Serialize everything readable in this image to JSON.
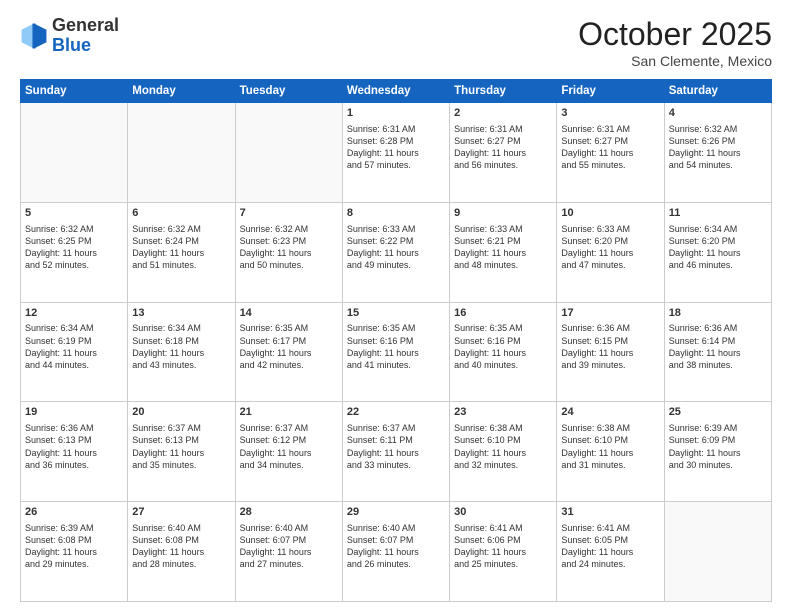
{
  "header": {
    "logo_general": "General",
    "logo_blue": "Blue",
    "month_title": "October 2025",
    "location": "San Clemente, Mexico"
  },
  "days_of_week": [
    "Sunday",
    "Monday",
    "Tuesday",
    "Wednesday",
    "Thursday",
    "Friday",
    "Saturday"
  ],
  "weeks": [
    [
      {
        "day": "",
        "info": ""
      },
      {
        "day": "",
        "info": ""
      },
      {
        "day": "",
        "info": ""
      },
      {
        "day": "1",
        "info": "Sunrise: 6:31 AM\nSunset: 6:28 PM\nDaylight: 11 hours\nand 57 minutes."
      },
      {
        "day": "2",
        "info": "Sunrise: 6:31 AM\nSunset: 6:27 PM\nDaylight: 11 hours\nand 56 minutes."
      },
      {
        "day": "3",
        "info": "Sunrise: 6:31 AM\nSunset: 6:27 PM\nDaylight: 11 hours\nand 55 minutes."
      },
      {
        "day": "4",
        "info": "Sunrise: 6:32 AM\nSunset: 6:26 PM\nDaylight: 11 hours\nand 54 minutes."
      }
    ],
    [
      {
        "day": "5",
        "info": "Sunrise: 6:32 AM\nSunset: 6:25 PM\nDaylight: 11 hours\nand 52 minutes."
      },
      {
        "day": "6",
        "info": "Sunrise: 6:32 AM\nSunset: 6:24 PM\nDaylight: 11 hours\nand 51 minutes."
      },
      {
        "day": "7",
        "info": "Sunrise: 6:32 AM\nSunset: 6:23 PM\nDaylight: 11 hours\nand 50 minutes."
      },
      {
        "day": "8",
        "info": "Sunrise: 6:33 AM\nSunset: 6:22 PM\nDaylight: 11 hours\nand 49 minutes."
      },
      {
        "day": "9",
        "info": "Sunrise: 6:33 AM\nSunset: 6:21 PM\nDaylight: 11 hours\nand 48 minutes."
      },
      {
        "day": "10",
        "info": "Sunrise: 6:33 AM\nSunset: 6:20 PM\nDaylight: 11 hours\nand 47 minutes."
      },
      {
        "day": "11",
        "info": "Sunrise: 6:34 AM\nSunset: 6:20 PM\nDaylight: 11 hours\nand 46 minutes."
      }
    ],
    [
      {
        "day": "12",
        "info": "Sunrise: 6:34 AM\nSunset: 6:19 PM\nDaylight: 11 hours\nand 44 minutes."
      },
      {
        "day": "13",
        "info": "Sunrise: 6:34 AM\nSunset: 6:18 PM\nDaylight: 11 hours\nand 43 minutes."
      },
      {
        "day": "14",
        "info": "Sunrise: 6:35 AM\nSunset: 6:17 PM\nDaylight: 11 hours\nand 42 minutes."
      },
      {
        "day": "15",
        "info": "Sunrise: 6:35 AM\nSunset: 6:16 PM\nDaylight: 11 hours\nand 41 minutes."
      },
      {
        "day": "16",
        "info": "Sunrise: 6:35 AM\nSunset: 6:16 PM\nDaylight: 11 hours\nand 40 minutes."
      },
      {
        "day": "17",
        "info": "Sunrise: 6:36 AM\nSunset: 6:15 PM\nDaylight: 11 hours\nand 39 minutes."
      },
      {
        "day": "18",
        "info": "Sunrise: 6:36 AM\nSunset: 6:14 PM\nDaylight: 11 hours\nand 38 minutes."
      }
    ],
    [
      {
        "day": "19",
        "info": "Sunrise: 6:36 AM\nSunset: 6:13 PM\nDaylight: 11 hours\nand 36 minutes."
      },
      {
        "day": "20",
        "info": "Sunrise: 6:37 AM\nSunset: 6:13 PM\nDaylight: 11 hours\nand 35 minutes."
      },
      {
        "day": "21",
        "info": "Sunrise: 6:37 AM\nSunset: 6:12 PM\nDaylight: 11 hours\nand 34 minutes."
      },
      {
        "day": "22",
        "info": "Sunrise: 6:37 AM\nSunset: 6:11 PM\nDaylight: 11 hours\nand 33 minutes."
      },
      {
        "day": "23",
        "info": "Sunrise: 6:38 AM\nSunset: 6:10 PM\nDaylight: 11 hours\nand 32 minutes."
      },
      {
        "day": "24",
        "info": "Sunrise: 6:38 AM\nSunset: 6:10 PM\nDaylight: 11 hours\nand 31 minutes."
      },
      {
        "day": "25",
        "info": "Sunrise: 6:39 AM\nSunset: 6:09 PM\nDaylight: 11 hours\nand 30 minutes."
      }
    ],
    [
      {
        "day": "26",
        "info": "Sunrise: 6:39 AM\nSunset: 6:08 PM\nDaylight: 11 hours\nand 29 minutes."
      },
      {
        "day": "27",
        "info": "Sunrise: 6:40 AM\nSunset: 6:08 PM\nDaylight: 11 hours\nand 28 minutes."
      },
      {
        "day": "28",
        "info": "Sunrise: 6:40 AM\nSunset: 6:07 PM\nDaylight: 11 hours\nand 27 minutes."
      },
      {
        "day": "29",
        "info": "Sunrise: 6:40 AM\nSunset: 6:07 PM\nDaylight: 11 hours\nand 26 minutes."
      },
      {
        "day": "30",
        "info": "Sunrise: 6:41 AM\nSunset: 6:06 PM\nDaylight: 11 hours\nand 25 minutes."
      },
      {
        "day": "31",
        "info": "Sunrise: 6:41 AM\nSunset: 6:05 PM\nDaylight: 11 hours\nand 24 minutes."
      },
      {
        "day": "",
        "info": ""
      }
    ]
  ]
}
